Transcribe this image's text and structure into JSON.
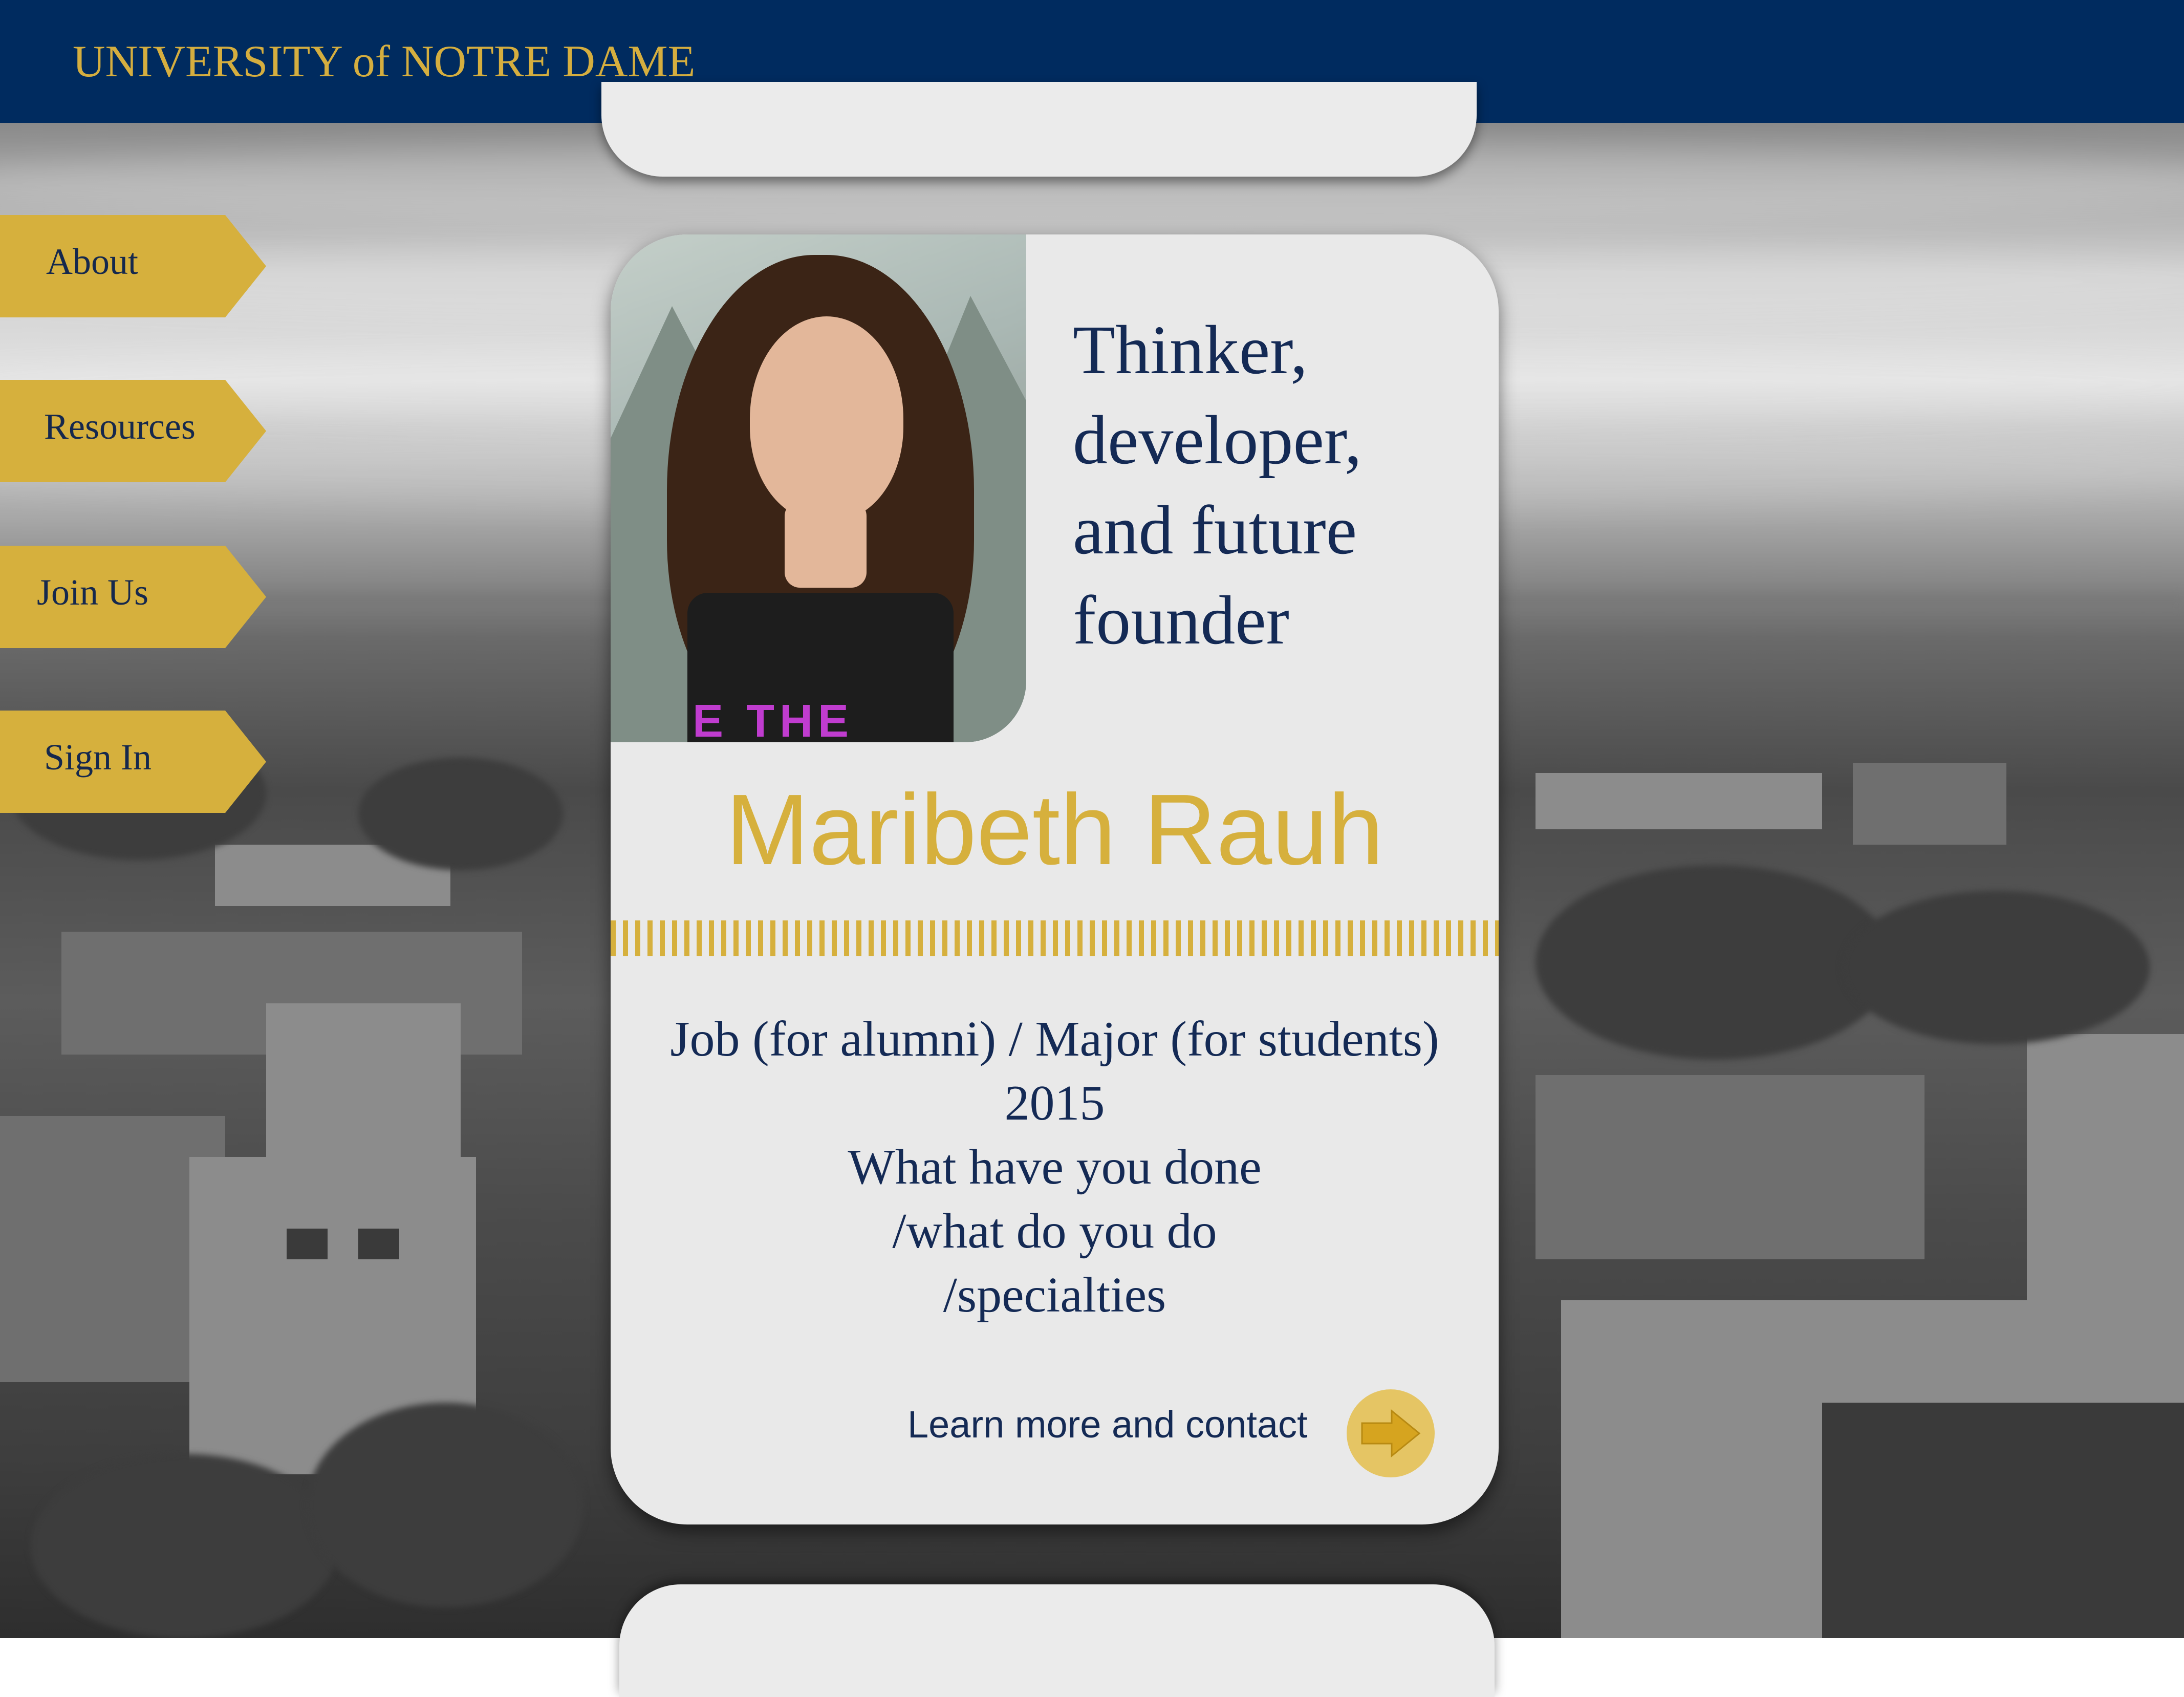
{
  "header": {
    "brand": "UNIVERSITY of NOTRE DAME"
  },
  "nav": {
    "items": [
      {
        "label": "About"
      },
      {
        "label": "Resources"
      },
      {
        "label": "Join Us"
      },
      {
        "label": "Sign In"
      }
    ]
  },
  "profile": {
    "tagline_lines": [
      "Thinker,",
      "developer,",
      "and future",
      "founder"
    ],
    "name": "Maribeth Rauh",
    "details": [
      "Job (for alumni) / Major (for students)",
      "2015",
      "What have you done",
      "/what do you do",
      "/specialties"
    ],
    "cta_label": "Learn more and contact",
    "cta_icon": "arrow-right-icon",
    "shirt_print": "E THE"
  },
  "colors": {
    "navy": "#002b5f",
    "gold": "#d6b03d",
    "card": "#e9e9e9",
    "text_navy": "#142a55"
  }
}
